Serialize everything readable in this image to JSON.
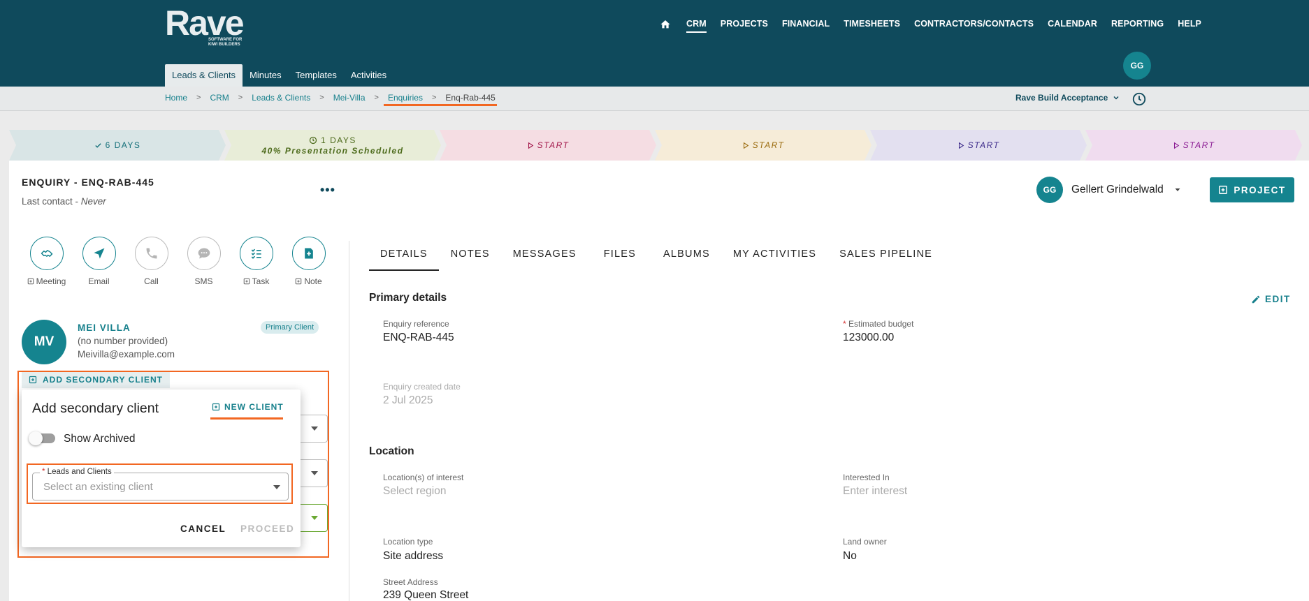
{
  "brand": {
    "name": "Rave",
    "tagline": "SOFTWARE FOR KIWI BUILDERS"
  },
  "nav": {
    "items": [
      {
        "label": "CRM",
        "active": true
      },
      {
        "label": "PROJECTS"
      },
      {
        "label": "FINANCIAL"
      },
      {
        "label": "TIMESHEETS"
      },
      {
        "label": "CONTRACTORS/CONTACTS"
      },
      {
        "label": "CALENDAR"
      },
      {
        "label": "REPORTING"
      },
      {
        "label": "HELP"
      }
    ],
    "user_initials": "GG"
  },
  "subnav": {
    "tabs": [
      "Leads & Clients",
      "Minutes",
      "Templates",
      "Activities"
    ]
  },
  "breadcrumb": [
    "Home",
    "CRM",
    "Leads & Clients",
    "Mei-Villa",
    "Enquiries",
    "Enq-Rab-445"
  ],
  "workspace": "Rave Build Acceptance",
  "pipeline": [
    {
      "label": "6 DAYS",
      "sub": "",
      "icon": "check-icon",
      "bg": "#d9e5e6",
      "color": "#15707a"
    },
    {
      "label": "1 DAYS",
      "sub": "40% Presentation Scheduled",
      "icon": "clock-icon",
      "bg": "#e8edd8",
      "color": "#4d6b1c"
    },
    {
      "label": "START",
      "sub": "",
      "icon": "play-icon",
      "bg": "#f5dde3",
      "color": "#a2174a"
    },
    {
      "label": "START",
      "sub": "",
      "icon": "play-icon",
      "bg": "#f6ecd8",
      "color": "#9a6a0c"
    },
    {
      "label": "START",
      "sub": "",
      "icon": "play-icon",
      "bg": "#e3e0f0",
      "color": "#3c2a8a"
    },
    {
      "label": "START",
      "sub": "",
      "icon": "play-icon",
      "bg": "#f0dcef",
      "color": "#8a1a93"
    }
  ],
  "enquiry": {
    "title": "ENQUIRY - ENQ-RAB-445",
    "last_contact_label": "Last contact - ",
    "last_contact_value": "Never",
    "assignee_initials": "GG",
    "assignee": "Gellert Grindelwald",
    "project_button": "PROJECT"
  },
  "actions": [
    {
      "label": "Meeting",
      "plus": true,
      "icon": "handshake-icon",
      "enabled": true
    },
    {
      "label": "Email",
      "plus": false,
      "icon": "send-icon",
      "enabled": true
    },
    {
      "label": "Call",
      "plus": false,
      "icon": "phone-icon",
      "enabled": false
    },
    {
      "label": "SMS",
      "plus": false,
      "icon": "chat-icon",
      "enabled": false
    },
    {
      "label": "Task",
      "plus": true,
      "icon": "checklist-icon",
      "enabled": true
    },
    {
      "label": "Note",
      "plus": true,
      "icon": "note-icon",
      "enabled": true
    }
  ],
  "client": {
    "initials": "MV",
    "name": "MEI VILLA",
    "phone": "(no number provided)",
    "email": "Meivilla@example.com",
    "badge": "Primary Client",
    "add_secondary": "ADD SECONDARY CLIENT"
  },
  "tabs": [
    "DETAILS",
    "NOTES",
    "MESSAGES",
    "FILES",
    "ALBUMS",
    "MY ACTIVITIES",
    "SALES PIPELINE"
  ],
  "details": {
    "primary_title": "Primary details",
    "edit_label": "EDIT",
    "enquiry_ref_label": "Enquiry reference",
    "enquiry_ref": "ENQ-RAB-445",
    "budget_label": "Estimated budget",
    "budget": "123000.00",
    "created_label": "Enquiry created date",
    "created": "2 Jul 2025",
    "location_title": "Location",
    "loc_interest_label": "Location(s) of interest",
    "loc_interest": "Select region",
    "interested_label": "Interested In",
    "interested": "Enter interest",
    "loc_type_label": "Location type",
    "loc_type": "Site address",
    "land_owner_label": "Land owner",
    "land_owner": "No",
    "street_label": "Street Address",
    "street": "239 Queen Street"
  },
  "dialog": {
    "title": "Add secondary client",
    "new_client": "NEW CLIENT",
    "show_archived": "Show Archived",
    "field_label": "Leads and Clients",
    "placeholder": "Select an existing client",
    "cancel": "CANCEL",
    "proceed": "PROCEED"
  },
  "colors": {
    "header": "#0f4a5c",
    "accent": "#15848f",
    "highlight": "#f26722"
  }
}
